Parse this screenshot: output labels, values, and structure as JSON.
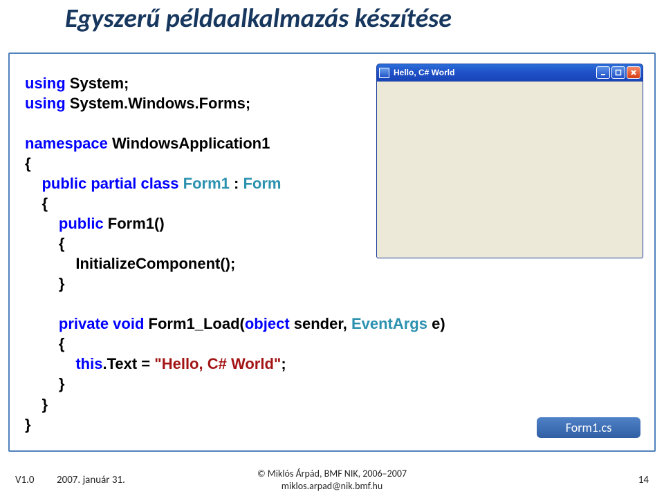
{
  "title": "Egyszerű példaalkalmazás készítése",
  "code": {
    "using1_kw": "using",
    "using1_rest": " System;",
    "using2_kw": "using",
    "using2_rest": " System.Windows.Forms;",
    "ns_kw": "namespace",
    "ns_rest": " WindowsApplication1",
    "brace_o": "{",
    "cls1_indent": "    ",
    "cls1_kw": "public partial class ",
    "cls1_type1": "Form1",
    "cls1_sep": " : ",
    "cls1_type2": "Form",
    "inner_brace_o": "    {",
    "ctor_indent": "        ",
    "ctor_kw": "public",
    "ctor_rest": " Form1()",
    "ctor_brace_o": "        {",
    "init_call": "            InitializeComponent();",
    "ctor_brace_c": "        }",
    "load_indent": "        ",
    "load_kw": "private void",
    "load_rest_a": " Form1_Load(",
    "load_kw2": "object",
    "load_rest_b": " sender, ",
    "load_type": "EventArgs",
    "load_rest_c": " e)",
    "load_brace_o": "        {",
    "this_indent": "            ",
    "this_kw": "this",
    "this_rest_a": ".Text = ",
    "this_str": "\"Hello, C# World\"",
    "this_rest_b": ";",
    "load_brace_c": "        }",
    "inner_brace_c": "    }",
    "brace_c": "}"
  },
  "screenshot": {
    "title": "Hello, C# World"
  },
  "file_label": "Form1.cs",
  "footer": {
    "version": "V1.0",
    "date": "2007. január 31.",
    "copyright_l1": "© Miklós Árpád, BMF NIK, 2006–2007",
    "copyright_l2": "miklos.arpad@nik.bmf.hu",
    "page": "14"
  }
}
